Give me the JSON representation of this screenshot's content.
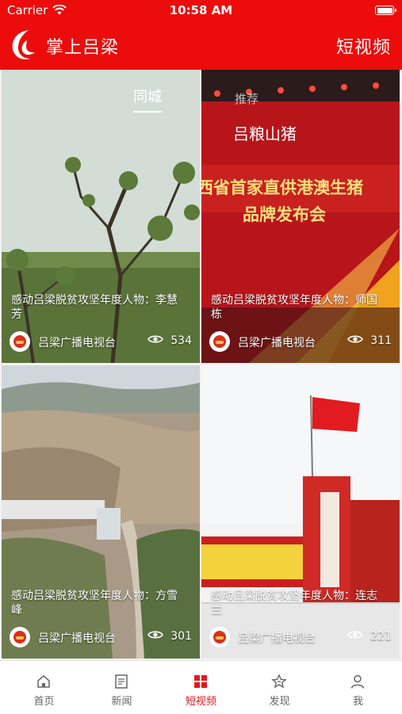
{
  "status_bar": {
    "carrier": "Carrier",
    "time": "10:58 AM"
  },
  "header": {
    "app_title": "掌上吕梁",
    "section_title": "短视频"
  },
  "tabs": [
    {
      "label": "同城",
      "active": true
    },
    {
      "label": "推荐",
      "active": false
    }
  ],
  "videos": [
    {
      "caption": "感动吕梁脱贫攻坚年度人物：李慧芳",
      "source": "吕梁广播电视台",
      "views": "534"
    },
    {
      "caption": "感动吕梁脱贫攻坚年度人物：师国栋",
      "source": "吕梁广播电视台",
      "views": "311"
    },
    {
      "caption": "感动吕梁脱贫攻坚年度人物：方雪峰",
      "source": "吕梁广播电视台",
      "views": "301"
    },
    {
      "caption": "感动吕梁脱贫攻坚年度人物：连志兰",
      "source": "吕梁广播电视台",
      "views": "221"
    }
  ],
  "video_scene_text": {
    "stage_brand": "吕粮山猪",
    "stage_line1": "西省首家直供港澳生猪",
    "stage_line2": "品牌发布会"
  },
  "bottom_nav": [
    {
      "label": "首页",
      "icon": "home-icon",
      "active": false
    },
    {
      "label": "新闻",
      "icon": "news-icon",
      "active": false
    },
    {
      "label": "短视频",
      "icon": "short-video-icon",
      "active": true
    },
    {
      "label": "发现",
      "icon": "discover-icon",
      "active": false
    },
    {
      "label": "我",
      "icon": "profile-icon",
      "active": false
    }
  ],
  "colors": {
    "brand_red": "#ec0c0c",
    "nav_active": "#e5171b",
    "nav_inactive": "#666666"
  }
}
